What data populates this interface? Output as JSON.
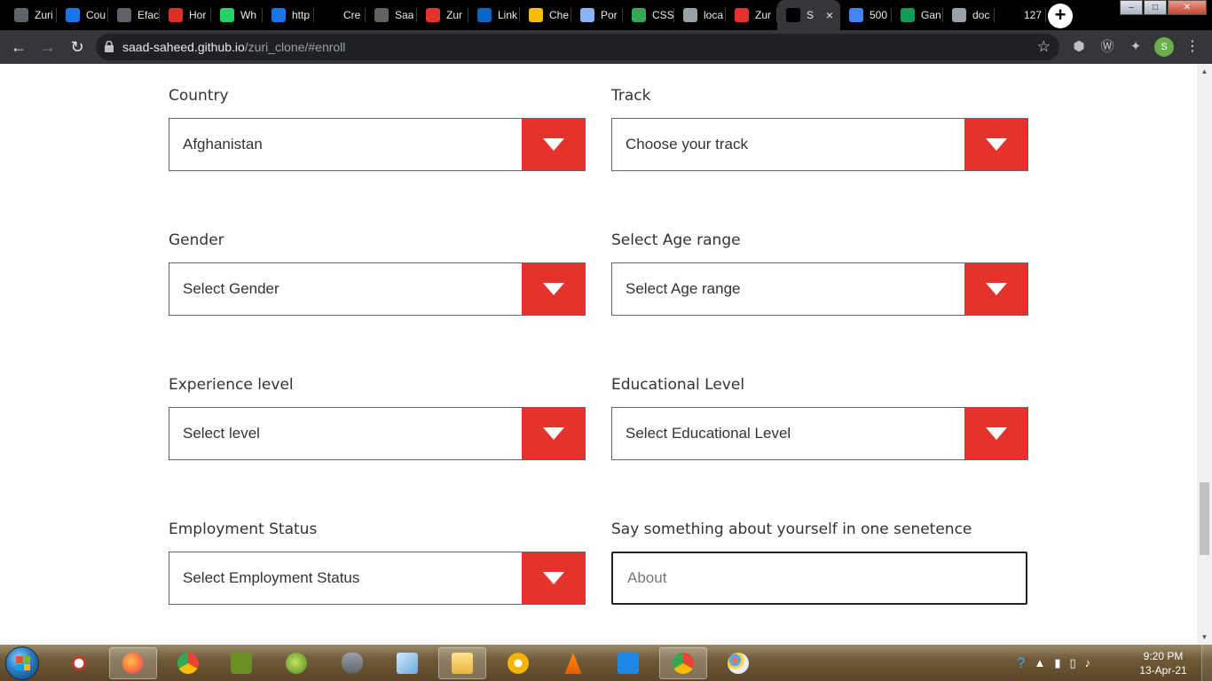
{
  "browser": {
    "tabs": [
      {
        "title": "Zuri",
        "icon": "globe-icon",
        "color": "#5f6368"
      },
      {
        "title": "Cou",
        "icon": "coursera-icon",
        "color": "#1a73e8"
      },
      {
        "title": "Efac",
        "icon": "globe-icon",
        "color": "#5f6368"
      },
      {
        "title": "Hor",
        "icon": "swirl-icon",
        "color": "#d93025"
      },
      {
        "title": "Wh",
        "icon": "whatsapp-icon",
        "color": "#25d366"
      },
      {
        "title": "http",
        "icon": "play-icon",
        "color": "#1a73e8"
      },
      {
        "title": "Cre",
        "icon": "blank-icon",
        "color": "#000000"
      },
      {
        "title": "Saa",
        "icon": "github-icon",
        "color": "#5f6368"
      },
      {
        "title": "Zur",
        "icon": "red-dot-icon",
        "color": "#e4332d"
      },
      {
        "title": "Link",
        "icon": "linkedin-icon",
        "color": "#0a66c2"
      },
      {
        "title": "Che",
        "icon": "gift-icon",
        "color": "#fbbc04"
      },
      {
        "title": "Por",
        "icon": "stripe-icon",
        "color": "#8ab4f8"
      },
      {
        "title": "CSS",
        "icon": "chart-icon",
        "color": "#34a853"
      },
      {
        "title": "loca",
        "icon": "grid-icon",
        "color": "#9aa0a6"
      },
      {
        "title": "Zur",
        "icon": "red-dot-icon",
        "color": "#e4332d"
      },
      {
        "title": "S",
        "icon": "s-dot-icon",
        "color": "#000000",
        "active": true
      },
      {
        "title": "500",
        "icon": "docs-icon",
        "color": "#4285f4"
      },
      {
        "title": "Gan",
        "icon": "sheets-icon",
        "color": "#0f9d58"
      },
      {
        "title": "doc",
        "icon": "list-icon",
        "color": "#9aa0a6"
      },
      {
        "title": "127",
        "icon": "s-dot-icon",
        "color": "#000000"
      }
    ],
    "active_tab_close": "×",
    "new_tab_label": "+",
    "url_host": "saad-saheed.github.io",
    "url_path": "/zuri_clone/#enroll",
    "profile_initial": "S"
  },
  "form": {
    "country": {
      "label": "Country",
      "value": "Afghanistan"
    },
    "track": {
      "label": "Track",
      "value": "Choose your track"
    },
    "gender": {
      "label": "Gender",
      "value": "Select Gender"
    },
    "age_range": {
      "label": "Select Age range",
      "value": "Select Age range"
    },
    "experience": {
      "label": "Experience level",
      "value": "Select level"
    },
    "education": {
      "label": "Educational Level",
      "value": "Select Educational Level"
    },
    "employment": {
      "label": "Employment Status",
      "value": "Select Employment Status"
    },
    "about": {
      "label": "Say something about yourself in one senetence",
      "placeholder": "About"
    }
  },
  "accent_color": "#e4332d",
  "taskbar": {
    "time": "9:20 PM",
    "date": "13-Apr-21"
  }
}
